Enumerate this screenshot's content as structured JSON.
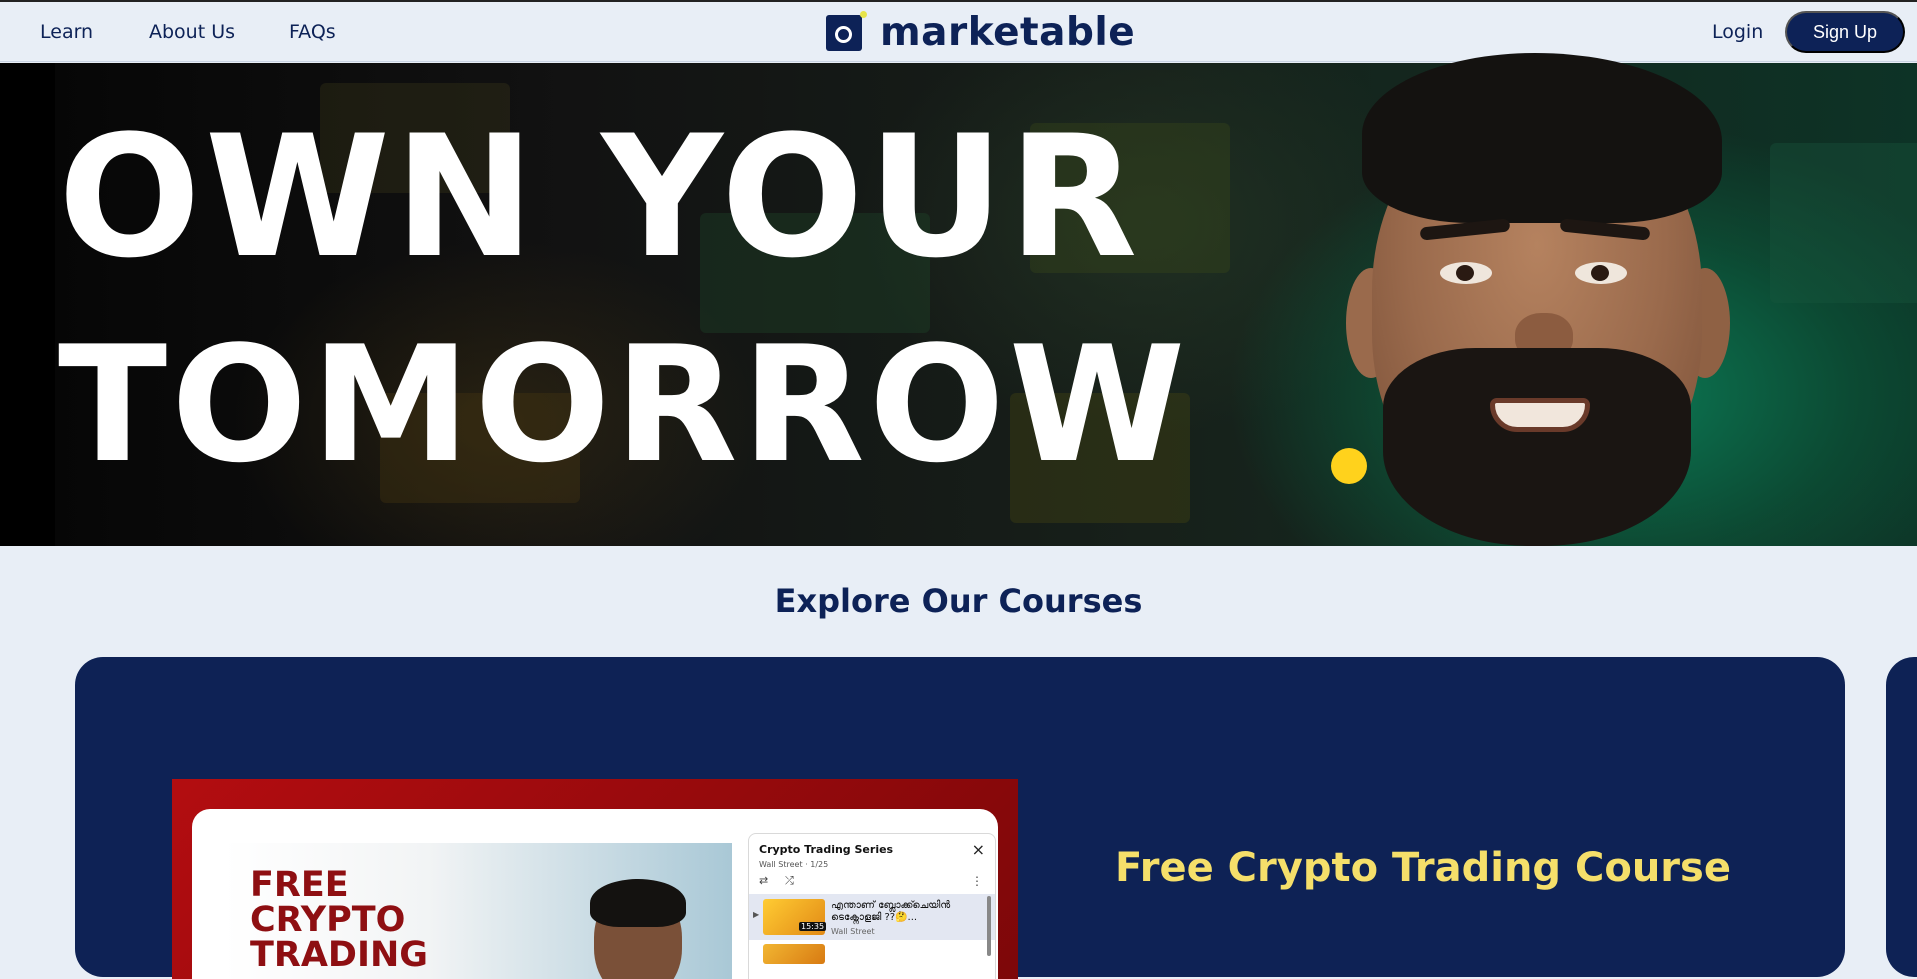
{
  "nav": {
    "links": [
      "Learn",
      "About Us",
      "FAQs"
    ],
    "logo_text": "marketable",
    "login": "Login",
    "signup": "Sign Up"
  },
  "hero": {
    "line1": "OWN YOUR",
    "line2": "TOMORROW",
    "accent_color": "#ffd21c"
  },
  "courses": {
    "section_title": "Explore Our Courses",
    "card": {
      "title": "Free Crypto Trading Course",
      "thumbnail_title": "FREE\nCRYPTO\nTRADING",
      "playlist": {
        "title": "Crypto Trading Series",
        "subtitle": "Wall Street · 1/25",
        "close_icon": "×",
        "item_title": "എന്താണ് ബ്ലോക്ക്ചെയിൻ ടെക്നോളജി ??🤔...",
        "item_channel": "Wall Street",
        "item_duration": "15:35"
      }
    }
  },
  "colors": {
    "brand_navy": "#0d2257",
    "card_bg": "#0e2255",
    "card_title": "#f5df6a",
    "page_bg": "#e8eef6"
  }
}
